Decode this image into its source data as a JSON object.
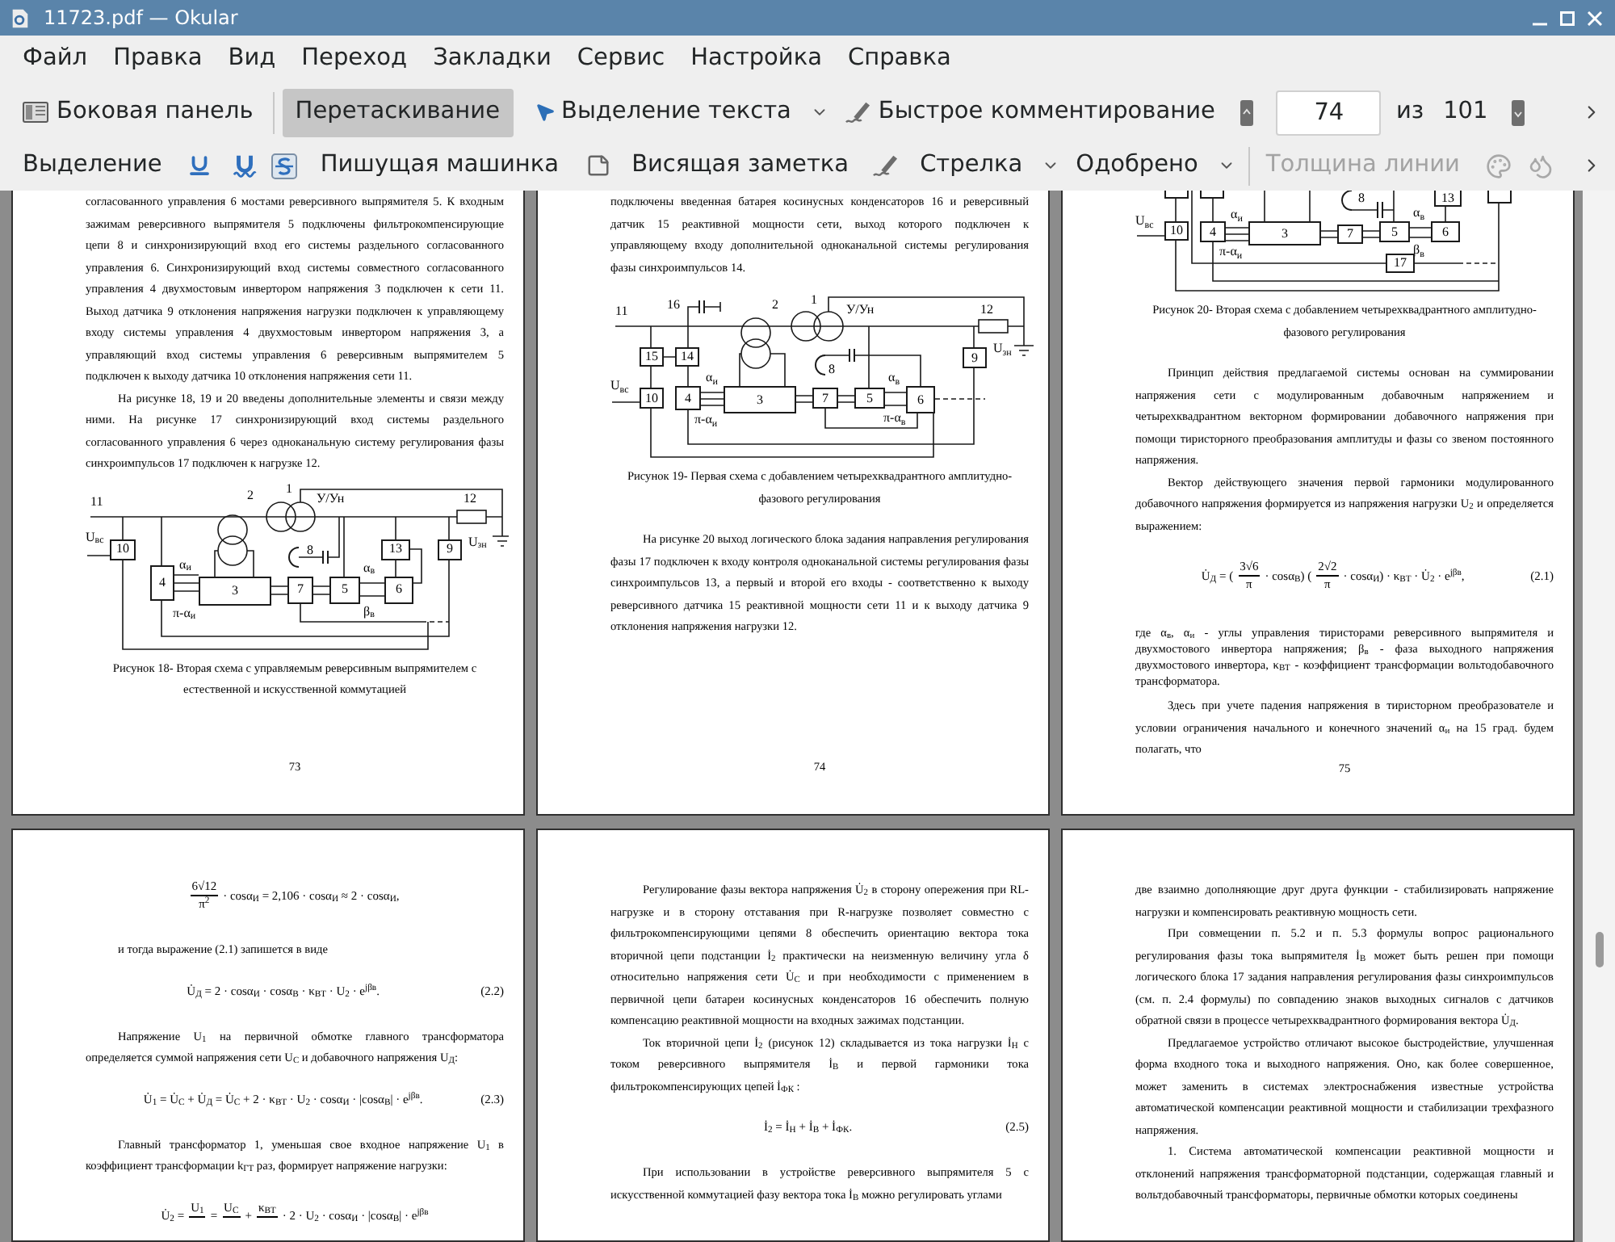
{
  "window": {
    "title": "11723.pdf — Okular"
  },
  "menu": [
    "Файл",
    "Правка",
    "Вид",
    "Переход",
    "Закладки",
    "Сервис",
    "Настройка",
    "Справка"
  ],
  "main_toolbar": {
    "sidebar": {
      "label": "Боковая панель"
    },
    "tools": [
      {
        "label": "Перетаскивание",
        "selected": true,
        "dropdown": false
      },
      {
        "label": "Выделение текста",
        "selected": false,
        "dropdown": true
      },
      {
        "label": "Быстрое комментирование",
        "selected": false,
        "dropdown": false
      }
    ],
    "page_nav": {
      "value": "74",
      "separator": "из",
      "total": "101"
    }
  },
  "annotation_toolbar": {
    "tools": [
      {
        "label": "Выделение",
        "dropdown": false
      },
      {
        "label": "Пишущая машинка",
        "dropdown": false
      },
      {
        "label": "Висящая заметка",
        "dropdown": false
      },
      {
        "label": "Стрелка",
        "dropdown": true
      },
      {
        "label": "Одобрено",
        "dropdown": true
      }
    ],
    "line_width": {
      "label": "Толщина линии",
      "disabled": true
    }
  },
  "pages": [
    {
      "number": "73",
      "blocks": [
        {
          "kind": "paragraph",
          "indent": false,
          "text": "согласованного управления 6 мостами реверсивного выпрямителя 5. К входным зажимам реверсивного выпрямителя 5 подключены фильтрокомпенсирующие цепи 8 и синхронизирующий вход его системы раздельного согласованного управления 6. Синхронизирующий вход системы совместного согласованного управления 4 двухмостовым инвертором напряжения 3 подключен к сети 11. Выход датчика 9 отклонения напряжения нагрузки подключен к управляющему входу системы управления 4 двухмостовым инвертором напряжения 3, а управляющий вход системы управления 6 реверсивным выпрямителем 5 подключен к выходу датчика 10 отклонения напряжения сети 11."
        },
        {
          "kind": "paragraph",
          "indent": true,
          "text": "На рисунке 18, 19 и 20 введены дополнительные элементы и связи между ними. На рисунке 17 синхронизирующий вход системы раздельного согласованного управления 6 через одноканальную систему регулирования фазы синхроимпульсов 17 подключен к нагрузке 12."
        },
        {
          "kind": "figure",
          "labels": [
            "11",
            "2",
            "1",
            "У/Ун",
            "12",
            "U$_{вс}$",
            "10",
            "8",
            "13",
            "9",
            "U$_{зн}$",
            "4",
            "α$_{и}$",
            "π-α$_{и}$",
            "3",
            "7",
            "5",
            "α$_{в}$",
            "β$_{в}$",
            "6"
          ],
          "caption": "Рисунок 18- Вторая схема с управляемым реверсивным выпрямителем с естественной и искусственной коммутацией"
        }
      ]
    },
    {
      "number": "74",
      "blocks": [
        {
          "kind": "paragraph",
          "indent": false,
          "text": "подключены введенная батарея косинусных конденсаторов 16 и реверсивный датчик 15 реактивной мощности сети, выход которого подключен к управляющему входу дополнительной одноканальной системы регулирования фазы синхроимпульсов 14."
        },
        {
          "kind": "figure",
          "labels": [
            "11",
            "16",
            "2",
            "1",
            "У/Ун",
            "12",
            "15",
            "14",
            "8",
            "9",
            "U$_{зн}$",
            "U$_{вс}$",
            "10",
            "4",
            "α$_{и}$",
            "π-α$_{и}$",
            "3",
            "7",
            "5",
            "α$_{в}$",
            "π-α$_{в}$",
            "6"
          ],
          "caption": "Рисунок 19- Первая схема с добавлением четырехквадрантного амплитудно-фазового регулирования"
        },
        {
          "kind": "paragraph",
          "indent": true,
          "text": "На рисунке 20 выход логического блока задания направления регулирования фазы 17 подключен к входу контроля одноканальной системы регулирования фазы синхроимпульсов 13, а первый и второй его входы - соответственно к выходу реверсивного датчика 15 реактивной мощности сети 11 и к выходу датчика 9 отклонения напряжения нагрузки 12."
        }
      ]
    },
    {
      "number": "75",
      "blocks": [
        {
          "kind": "figure",
          "labels": [
            "8",
            "13",
            "U$_{вс}$",
            "10",
            "4",
            "α$_{и}$",
            "π-α$_{и}$",
            "3",
            "7",
            "5",
            "α$_{в}$",
            "β$_{в}$",
            "6",
            "17"
          ],
          "caption": "Рисунок 20- Вторая схема с добавлением четырехквадрантного амплитудно-фазового регулирования"
        },
        {
          "kind": "paragraph",
          "indent": true,
          "text": "Принцип действия предлагаемой системы основан на суммировании напряжения сети с модулированным добавочным напряжением и четырехквадрантном векторном формировании добавочного напряжения при помощи тиристорного преобразования амплитуды и фазы со звеном постоянного напряжения."
        },
        {
          "kind": "paragraph",
          "indent": true,
          "text": "Вектор действующего значения первой гармоники модулированного добавочного напряжения формируется из напряжения нагрузки U$_{2}$ и определяется выражением:"
        },
        {
          "kind": "formula",
          "parts": [
            {
              "kind": "text",
              "text": "U̇$_{Д}$ = ("
            },
            {
              "kind": "fraction",
              "num": "3√6",
              "den": "π"
            },
            {
              "kind": "text",
              "text": "· cosα$_{В}$) ("
            },
            {
              "kind": "fraction",
              "num": "2√2",
              "den": "π"
            },
            {
              "kind": "text",
              "text": "· cosα$_{И}$) · κ$_{ВТ}$ · U̇$_{2}$ · e$^{jβв}$,"
            }
          ],
          "number": "(2.1)"
        },
        {
          "kind": "legend",
          "indent": false,
          "text": "где α$_{в}$, α$_{и}$ - углы управления тиристорами реверсивного выпрямителя и двухмостового инвертора напряжения; β$_{в}$ - фаза выходного напряжения двухмостового инвертора, κ$_{ВТ}$ - коэффициент трансформации вольтодобавочного трансформатора."
        },
        {
          "kind": "paragraph",
          "indent": true,
          "text": "Здесь при учете падения напряжения в тиристорном преобразователе и условии ограничения начального и конечного значений α$_{и}$ на 15 град. будем полагать, что"
        }
      ]
    },
    {
      "blocks": [
        {
          "kind": "formula",
          "parts": [
            {
              "kind": "fraction",
              "num": "6√12",
              "den": "π$^{2}$"
            },
            {
              "kind": "text",
              "text": "· cosα$_{И}$ = 2,106 · cosα$_{И}$ ≈ 2 · cosα$_{И}$,"
            }
          ]
        },
        {
          "kind": "paragraph",
          "indent": true,
          "text": "и тогда выражение (2.1) запишется в виде"
        },
        {
          "kind": "formula",
          "parts": [
            {
              "kind": "text",
              "text": "U̇$_{Д}$ = 2 · cosα$_{И}$ · cosα$_{В}$ · κ$_{ВТ}$ · U$_{2}$ · e$^{jβв}$."
            }
          ],
          "number": "(2.2)"
        },
        {
          "kind": "paragraph",
          "indent": true,
          "text": "Напряжение U$_{1}$ на первичной обмотке главного трансформатора определяется суммой напряжения сети U$_{С}$ и добавочного напряжения U$_{Д}$:"
        },
        {
          "kind": "formula",
          "parts": [
            {
              "kind": "text",
              "text": "U̇$_{1}$ = U̇$_{С}$ + U̇$_{Д}$ = U̇$_{С}$ + 2 · κ$_{ВТ}$ · U$_{2}$ · cosα$_{И}$ · |cosα$_{В}$| · e$^{jβв}$."
            }
          ],
          "number": "(2.3)"
        },
        {
          "kind": "paragraph",
          "indent": true,
          "text": "Главный трансформатор 1, уменьшая свое входное напряжение U$_{1}$ в коэффициент трансформации k$_{ГТ}$ раз, формирует напряжение нагрузки:"
        },
        {
          "kind": "formula",
          "parts": [
            {
              "kind": "text",
              "text": "U̇$_{2}$ ="
            },
            {
              "kind": "fraction",
              "num": "U$_{1}$"
            },
            {
              "kind": "text",
              "text": "="
            },
            {
              "kind": "fraction",
              "num": "U$_{С}$"
            },
            {
              "kind": "text",
              "text": "+"
            },
            {
              "kind": "fraction",
              "num": "κ$_{ВТ}$"
            },
            {
              "kind": "text",
              "text": "· 2 · U$_{2}$ · cosα$_{И}$ · |cosα$_{В}$| · e$^{jβв}$"
            }
          ]
        }
      ]
    },
    {
      "blocks": [
        {
          "kind": "paragraph",
          "indent": true,
          "text": "Регулирование фазы вектора напряжения U̇$_{2}$ в сторону опережения при RL-нагрузке и в сторону отставания при R-нагрузке позволяет совместно с фильтрокомпенсирующими цепями 8 обеспечить ориентацию вектора тока вторичной цепи подстанции İ$_{2}$ практически на неизменную величину угла δ относительно напряжения сети U̇$_{С}$ и при необходимости с применением в первичной цепи батареи косинусных конденсаторов 16 обеспечить полную компенсацию реактивной мощности на входных зажимах подстанции."
        },
        {
          "kind": "paragraph",
          "indent": true,
          "text": "Ток вторичной цепи İ$_{2}$ (рисунок 12) складывается из тока нагрузки İ$_{Н}$ с током реверсивного выпрямителя İ$_{В}$ и первой гармоники тока фильтрокомпенсирующих цепей İ$_{ФК}$ :"
        },
        {
          "kind": "formula",
          "parts": [
            {
              "kind": "text",
              "text": "İ$_{2}$ = İ$_{Н}$ + İ$_{В}$ + İ$_{ФК}$."
            }
          ],
          "number": "(2.5)"
        },
        {
          "kind": "paragraph",
          "indent": true,
          "text": "При использовании в устройстве реверсивного выпрямителя 5 с искусственной коммутацией фазу вектора тока İ$_{В}$ можно регулировать углами"
        }
      ]
    },
    {
      "blocks": [
        {
          "kind": "paragraph",
          "indent": false,
          "text": "две взаимно дополняющие друг друга функции - стабилизировать напряжение нагрузки и компенсировать реактивную мощность сети."
        },
        {
          "kind": "paragraph",
          "indent": true,
          "text": "При совмещении п. 5.2 и п. 5.3 формулы вопрос рационального регулирования фазы тока выпрямителя İ$_{В}$ может быть решен при помощи логического блока 17 задания направления регулирования фазы синхроимпульсов (см. п. 2.4 формулы) по совпадению знаков выходных сигналов с датчиков обратной связи в процессе четырехквадрантного формирования вектора U̇$_{Д}$."
        },
        {
          "kind": "paragraph",
          "indent": true,
          "text": "Предлагаемое устройство отличают высокое быстродействие, улучшенная форма входного тока и выходного напряжения. Оно, как более совершенное, может заменить в системах электроснабжения известные устройства автоматической компенсации реактивной мощности и стабилизации трехфазного напряжения."
        },
        {
          "kind": "paragraph",
          "indent": true,
          "text": "1. Система автоматической компенсации реактивной мощности и отклонений напряжения трансформаторной подстанции, содержащая главный и вольтдобавочный трансформаторы, первичные обмотки которых соединены"
        }
      ]
    }
  ]
}
